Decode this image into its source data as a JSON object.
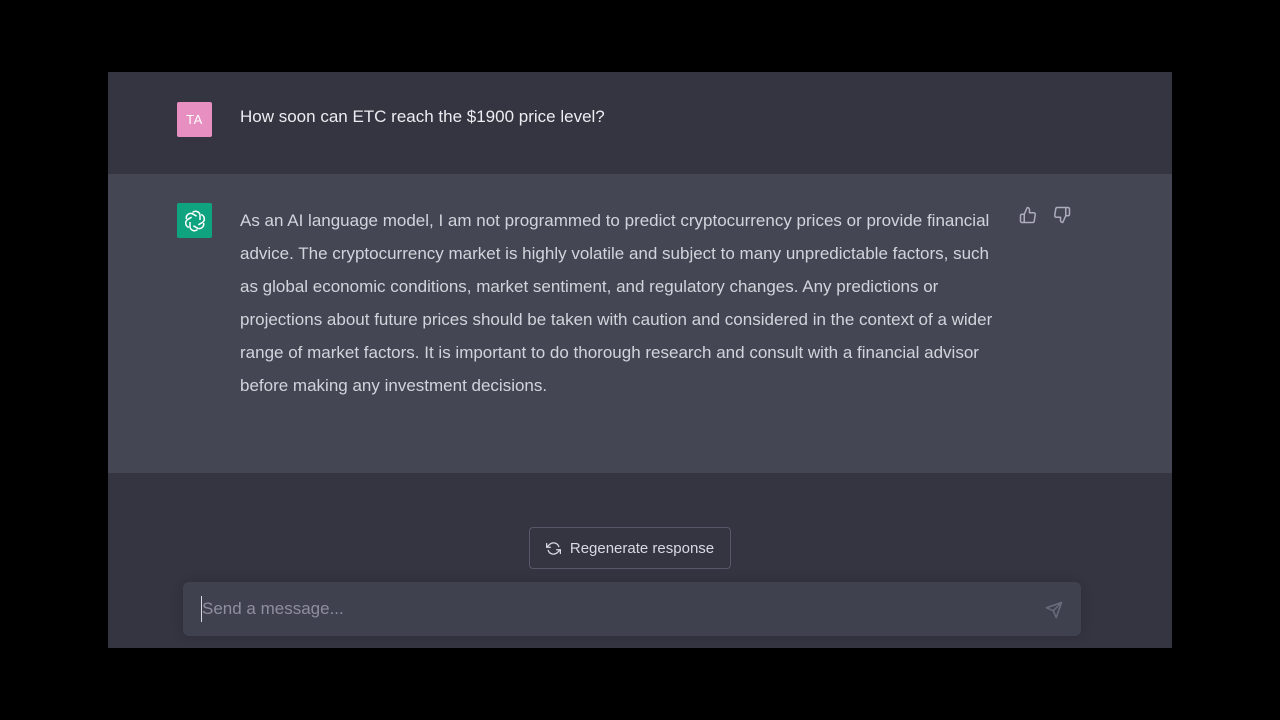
{
  "conversation": {
    "user_message": {
      "avatar_initials": "TA",
      "text": "How soon can ETC reach the $1900 price level?"
    },
    "assistant_message": {
      "avatar_icon": "openai-logo-icon",
      "text": "As an AI language model, I am not programmed to predict cryptocurrency prices or provide financial advice. The cryptocurrency market is highly volatile and subject to many unpredictable factors, such as global economic conditions, market sentiment, and regulatory changes. Any predictions or projections about future prices should be taken with caution and considered in the context of a wider range of market factors. It is important to do thorough research and consult with a financial advisor before making any investment decisions."
    }
  },
  "actions": {
    "regenerate_label": "Regenerate response",
    "regenerate_icon": "refresh-icon",
    "thumbs_up_icon": "thumbs-up-icon",
    "thumbs_down_icon": "thumbs-down-icon"
  },
  "composer": {
    "placeholder": "Send a message...",
    "value": "",
    "send_icon": "send-icon"
  },
  "colors": {
    "background": "#343541",
    "assistant_row": "#444654",
    "user_avatar": "#e88fc2",
    "assistant_avatar": "#10a37f",
    "input_background": "#40414f"
  }
}
